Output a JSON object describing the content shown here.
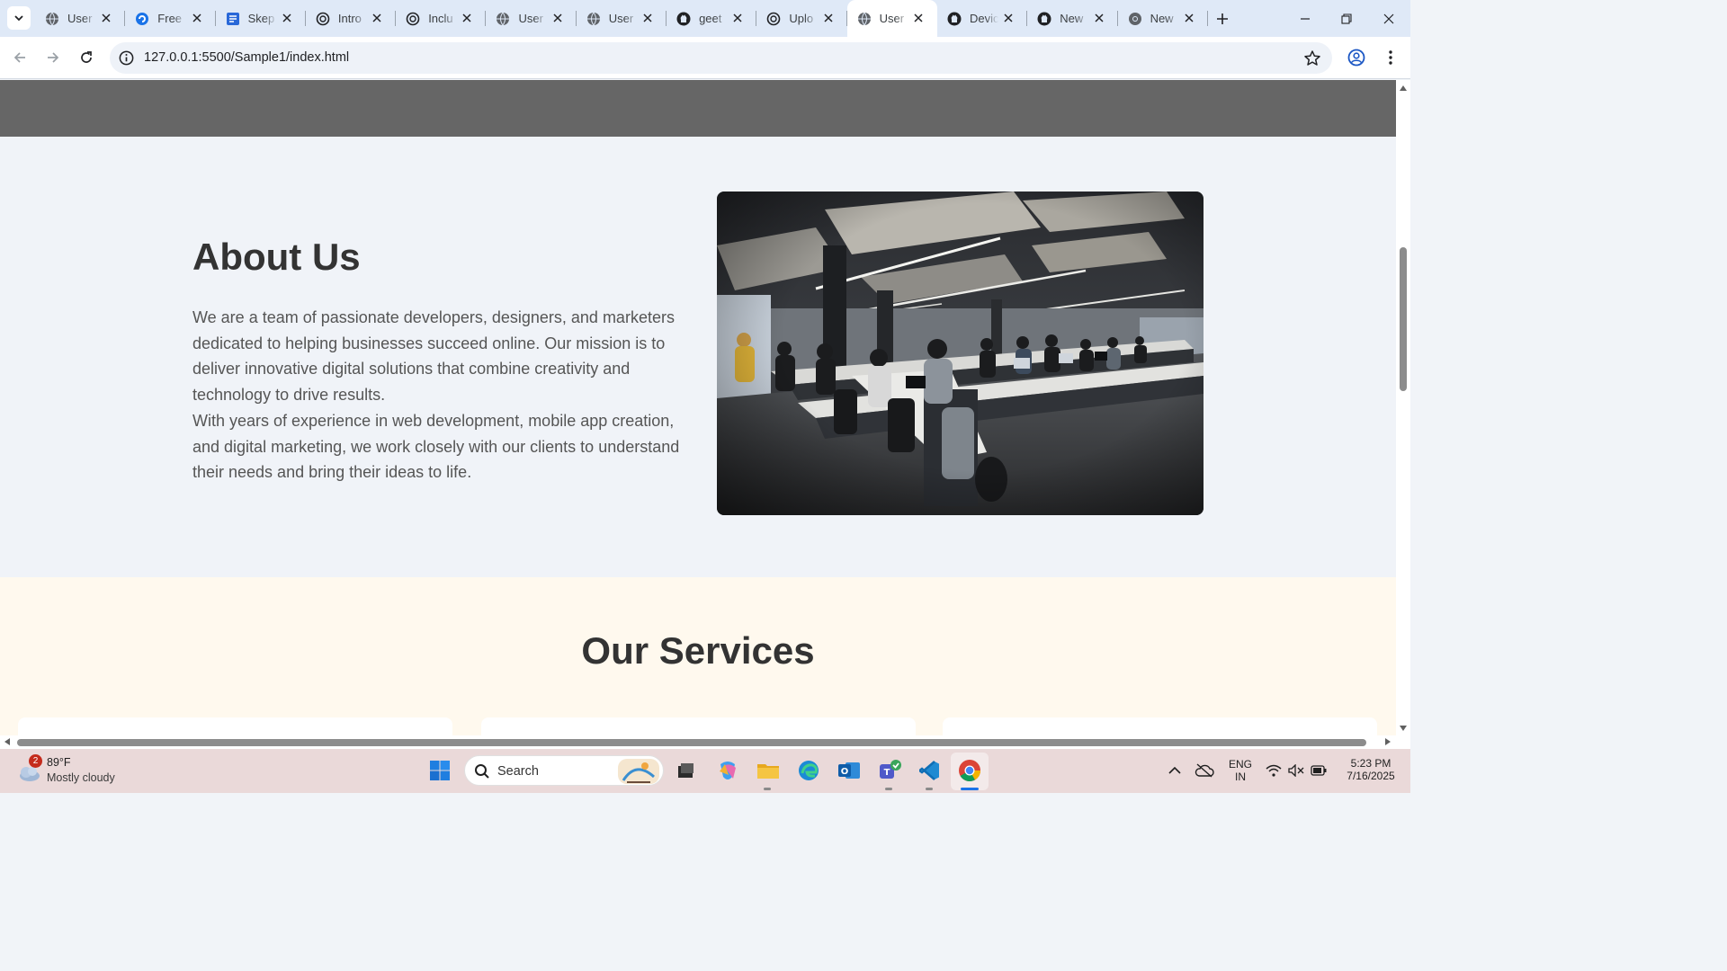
{
  "browser": {
    "tabs": [
      {
        "title": "User",
        "icon": "globe-icon",
        "active": false
      },
      {
        "title": "Free",
        "icon": "copilot-icon",
        "active": false
      },
      {
        "title": "Skep",
        "icon": "form-icon",
        "active": false
      },
      {
        "title": "Intro",
        "icon": "openai-icon",
        "active": false
      },
      {
        "title": "Inclu",
        "icon": "openai-icon",
        "active": false
      },
      {
        "title": "User",
        "icon": "globe-icon",
        "active": false
      },
      {
        "title": "User",
        "icon": "globe-icon",
        "active": false
      },
      {
        "title": "geet",
        "icon": "github-icon",
        "active": false
      },
      {
        "title": "Uplo",
        "icon": "openai-icon",
        "active": false
      },
      {
        "title": "User",
        "icon": "globe-icon",
        "active": true
      },
      {
        "title": "Devic",
        "icon": "github-icon",
        "active": false
      },
      {
        "title": "New",
        "icon": "github-icon",
        "active": false
      },
      {
        "title": "New",
        "icon": "chrome-icon",
        "active": false
      }
    ],
    "url": "127.0.0.1:5500/Sample1/index.html"
  },
  "page": {
    "about": {
      "title": "About Us",
      "paragraph1": "We are a team of passionate developers, designers, and marketers dedicated to helping businesses succeed online. Our mission is to deliver innovative digital solutions that combine creativity and technology to drive results.",
      "paragraph2": "With years of experience in web development, mobile app creation, and digital marketing, we work closely with our clients to understand their needs and bring their ideas to life."
    },
    "services": {
      "title": "Our Services"
    }
  },
  "taskbar": {
    "weather": {
      "temp": "89°F",
      "condition": "Mostly cloudy",
      "badge": "2"
    },
    "search_label": "Search",
    "language": {
      "line1": "ENG",
      "line2": "IN"
    },
    "clock": {
      "time": "5:23 PM",
      "date": "7/16/2025"
    }
  },
  "colors": {
    "tabstrip": "#dfe9f7",
    "page_bg": "#f0f3f8",
    "services_bg": "#fff9ee",
    "heading": "#333333",
    "body_text": "#555555",
    "taskbar": "#ead9d9"
  }
}
